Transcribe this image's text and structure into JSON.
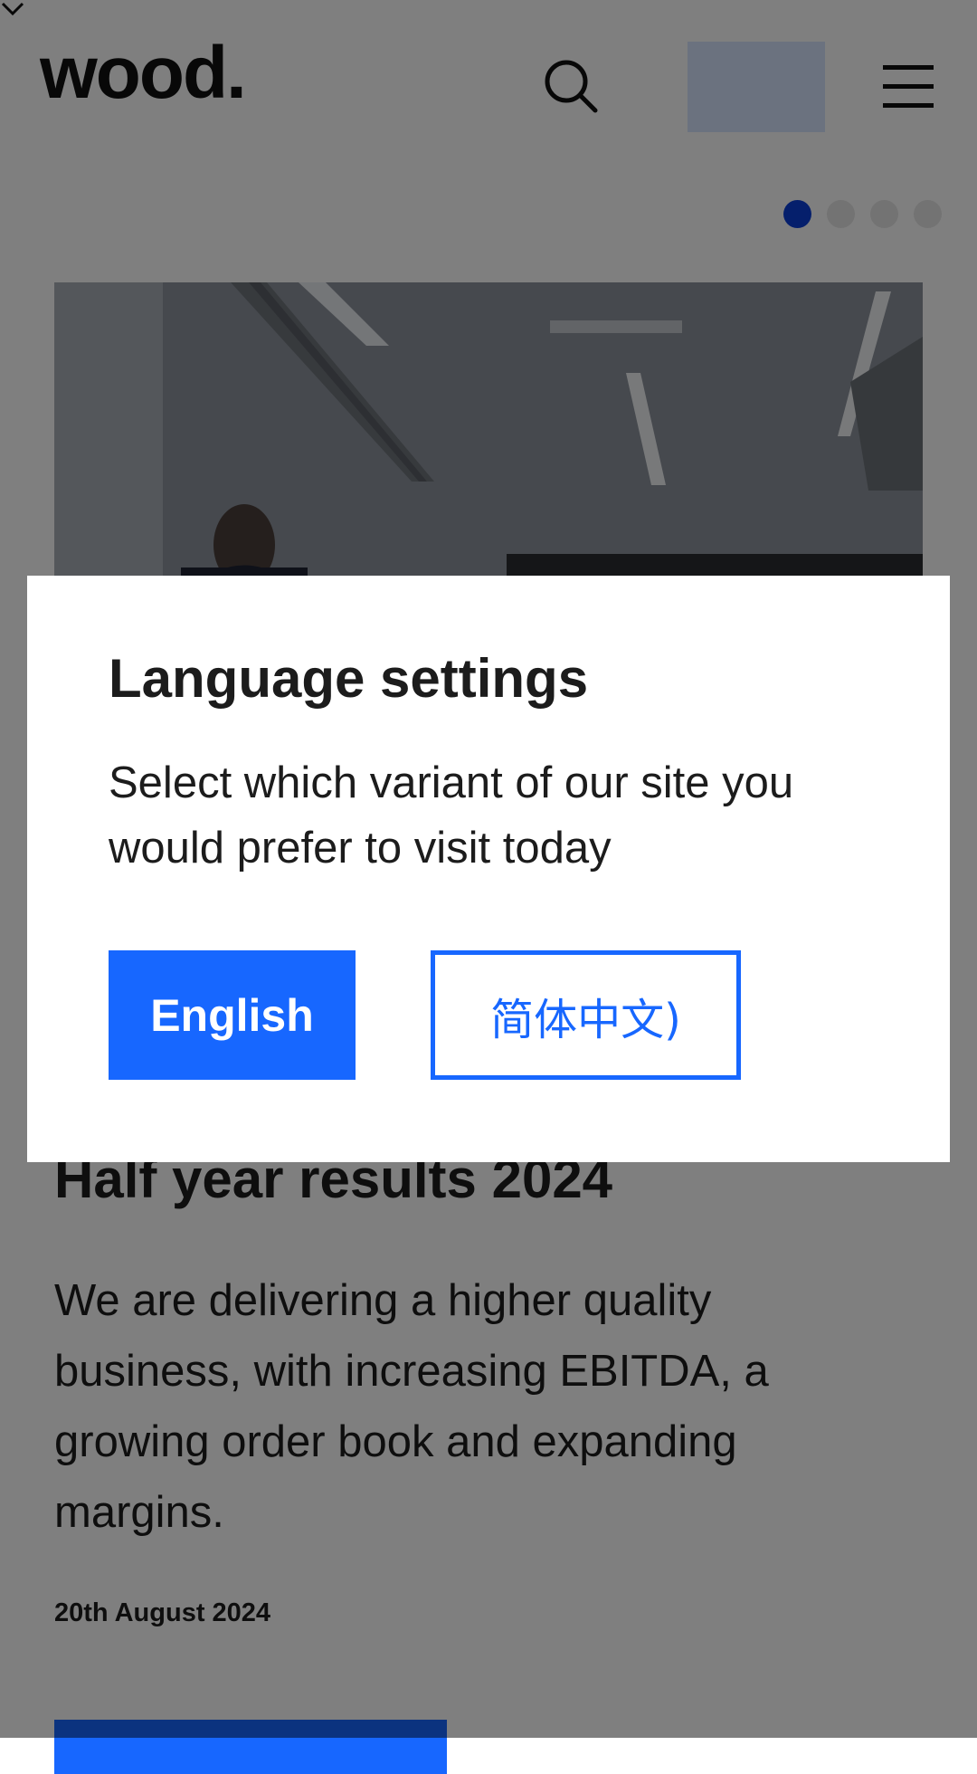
{
  "header": {
    "logo_text": "wood.",
    "search_icon": "search-icon",
    "language_selector_icon": "chevron-down-icon",
    "menu_icon": "hamburger-menu-icon"
  },
  "carousel": {
    "dot_count": 4,
    "active_index": 0
  },
  "article": {
    "title": "Half year results 2024",
    "summary": "We are delivering a higher quality business, with increasing EBITDA, a growing order book and expanding margins.",
    "date": "20th August 2024"
  },
  "modal": {
    "title": "Language settings",
    "text": "Select which variant of our site you would prefer to visit today",
    "english_label": "English",
    "chinese_label": "简体中文)"
  },
  "colors": {
    "accent": "#1767ff",
    "active_dot": "#0b3fd8",
    "selector_bg": "#d6e4ff"
  }
}
